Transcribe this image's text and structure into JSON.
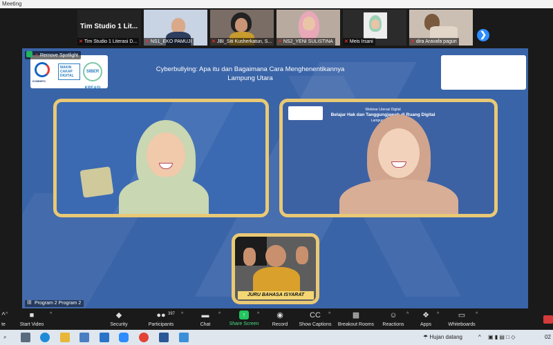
{
  "window": {
    "title": "Meeting"
  },
  "gallery": {
    "tiles": [
      {
        "name": "Tim Studio 1 Literasi D...",
        "big_name": "Tim Studio 1 Lit..."
      },
      {
        "name": "NS1_EKO PAMUJI"
      },
      {
        "name": "JBI_Siti Kusherkatun, S..."
      },
      {
        "name": "NS2_YENI SULISTINA"
      },
      {
        "name": "Meis Irsani"
      },
      {
        "name": "dira Aravafa pagun"
      }
    ],
    "next_icon": "chevron-right-icon"
  },
  "spotlight": {
    "remove_label": "Remove Spotlight",
    "title_line1": "Cyberbullying: Apa itu dan Bagaimana Cara Menghenentikannya",
    "title_line2": "Lampung Utara",
    "logo_kominfo": "KOMINFO",
    "logo_mcd": "MAKIN CAKAP DIGITAL",
    "logo_siber": "SIBER KREASI",
    "slide_line1": "Webinar Literasi Digital",
    "slide_line2": "Belajar Hak dan Tanggungjawab di Ruang Digital",
    "slide_line3": "Lampung Utara",
    "interpreter_label": "JURU BAHASA ISYARAT",
    "program_label": "Program 2 Program 2"
  },
  "toolbar": {
    "video_label": "Start Video",
    "security_label": "Security",
    "participants_label": "Participants",
    "participants_count": "397",
    "chat_label": "Chat",
    "share_label": "Share Screen",
    "record_label": "Record",
    "captions_label": "Show Captions",
    "breakout_label": "Breakout Rooms",
    "reactions_label": "Reactions",
    "apps_label": "Apps",
    "whiteboards_label": "Whiteboards",
    "mute_label": "te"
  },
  "taskbar": {
    "weather_text": "Hujan datang",
    "clock_partial": "02"
  },
  "colors": {
    "stage_blue": "#3a64a8",
    "frame_gold": "#e9c975",
    "zoom_blue": "#2d8cff",
    "share_green": "#22c55e"
  }
}
